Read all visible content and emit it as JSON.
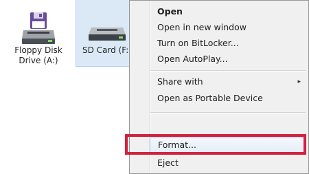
{
  "drives": [
    {
      "label_line1": "Floppy Disk",
      "label_line2": "Drive (A:)",
      "icon": "floppy-drive-icon"
    },
    {
      "label_line1": "SD Card (F:)",
      "label_line2": "",
      "icon": "sd-card-drive-icon"
    }
  ],
  "context_menu": {
    "items": [
      {
        "label": "Open"
      },
      {
        "label": "Open in new window"
      },
      {
        "label": "Turn on BitLocker..."
      },
      {
        "label": "Open AutoPlay..."
      },
      {
        "label": "Share with",
        "arrow": "▸"
      },
      {
        "label": "Open as Portable Device"
      },
      {
        "label": "Format..."
      },
      {
        "label": "Eject"
      }
    ]
  },
  "colors": {
    "highlight_outline": "#d4213d",
    "selection_background": "#dbe9f7",
    "menu_background": "#f0f0f0"
  }
}
